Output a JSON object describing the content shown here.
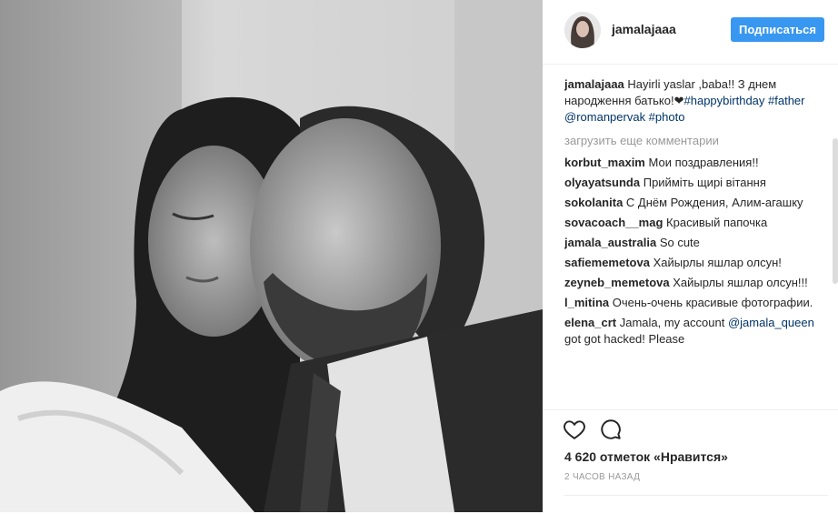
{
  "post": {
    "username": "jamalajaaa",
    "follow_label": "Подписаться",
    "caption_username": "jamalajaaa",
    "caption_text": "Hayirli yaslar ,baba!! З днем народження батько!❤",
    "caption_tags": "#happybirthday #father @romanpervak #photo",
    "load_more": "загрузить еще комментарии",
    "comments": [
      {
        "user": "korbut_maxim",
        "text": "Мои поздравления!!"
      },
      {
        "user": "olyayatsunda",
        "text": "Прийміть щирі вітання"
      },
      {
        "user": "sokolanita",
        "text": "С Днём Рождения, Алим-агашку"
      },
      {
        "user": "sovacoach__mag",
        "text": "Красивый папочка"
      },
      {
        "user": "jamala_australia",
        "text": "So cute"
      },
      {
        "user": "safiememetova",
        "text": "Хайырлы яшлар олсун!"
      },
      {
        "user": "zeyneb_memetova",
        "text": "Хайырлы яшлар олсун!!!"
      },
      {
        "user": "l_mitina",
        "text": "Очень-очень красивые фотографии."
      },
      {
        "user": "elena_crt",
        "text": "Jamala, my account",
        "mention": "@jamala_queen",
        "text2": "got got hacked! Please"
      }
    ],
    "likes": "4 620 отметок «Нравится»",
    "time": "2 ЧАСОВ НАЗАД"
  },
  "icons": {
    "like": "heart-icon",
    "comment": "comment-icon"
  },
  "colors": {
    "accent": "#3897f0",
    "link": "#003569",
    "muted": "#999999"
  }
}
